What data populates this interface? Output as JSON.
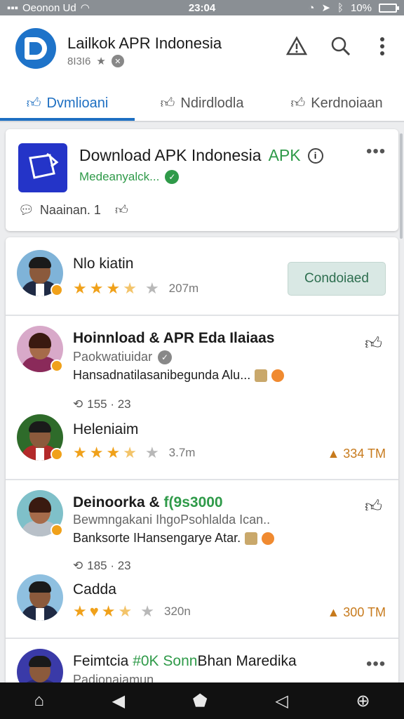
{
  "status_bar": {
    "carrier": "Oeonon Ud",
    "time": "23:04",
    "battery": "10%",
    "battery_level": 0.4
  },
  "header": {
    "title": "Lailkok APR Indonesia",
    "subtitle": "8I3I6",
    "icons": [
      "warning-icon",
      "search-icon",
      "more-vert-icon"
    ]
  },
  "tabs": [
    {
      "label": "Dvmlioani",
      "icon": "thumb-up-icon",
      "active": true
    },
    {
      "label": "Ndirdlodla",
      "icon": "thumb-up-icon",
      "active": false
    },
    {
      "label": "Kerdnoiaan",
      "icon": "thumb-up-icon",
      "active": false
    }
  ],
  "featured": {
    "title": "Download APK Indonesia",
    "title_tag": "APK",
    "subtitle": "Medeanyalck...",
    "meta": "Naainan. 1"
  },
  "list": [
    {
      "title": "Nlo kiatin",
      "rating": 3.5,
      "meta": "207m",
      "button": "Condoiaed"
    },
    {
      "title": "Hoinnload & APR Eda Ilaiaas",
      "line1": "Paokwatiuidar",
      "line2": "Hansadnatilasanibegunda Alu...",
      "counts": "155 · 23"
    },
    {
      "title": "Heleniaim",
      "rating": 3.5,
      "meta": "3.7m",
      "right": "334 TM"
    },
    {
      "title_a": "Deinoorka &",
      "title_b": "f(9s3000",
      "line1": "Bewmngakani IhgoPsohlalda Ican..",
      "line2": "Banksorte IHansengarye Atar.",
      "counts": "185 · 23"
    },
    {
      "title": "Cadda",
      "rating": 3.5,
      "meta": "320n",
      "right": "300 TM"
    },
    {
      "title_a": "Feimtcia",
      "title_b": "#0K Sonn",
      "title_c": "Bhan Maredika",
      "line1": "Padionaiamun"
    }
  ],
  "colors": {
    "accent": "#1e6fc2",
    "green": "#2f9a49",
    "star": "#f0a11a"
  }
}
